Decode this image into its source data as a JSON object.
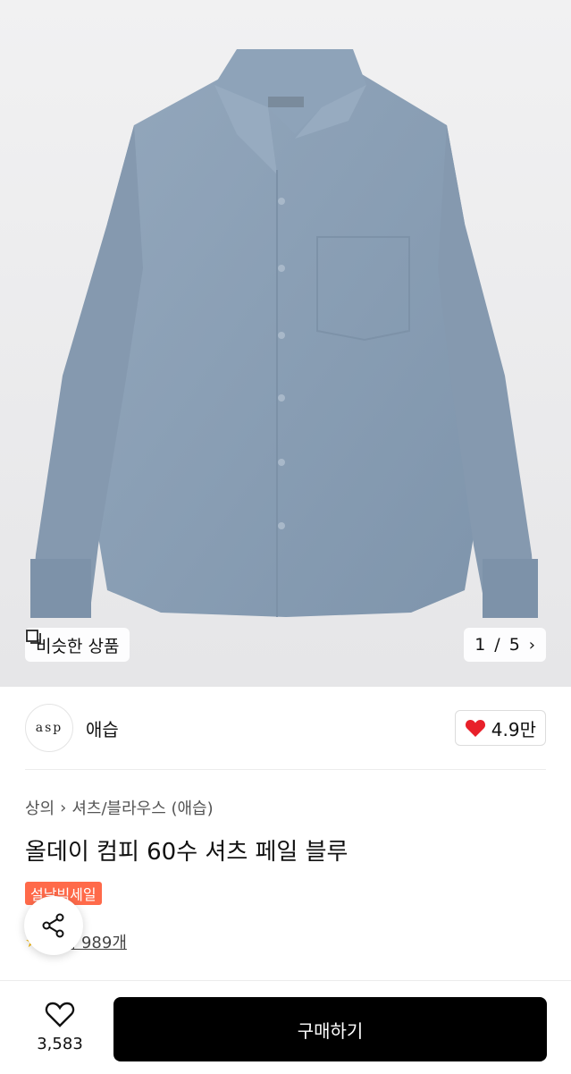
{
  "hero": {
    "similar_label": "비슷한 상품",
    "page_current": "1",
    "page_sep": "/",
    "page_total": "5"
  },
  "brand": {
    "logo_text": "asp",
    "name": "애습",
    "likes": "4.9만"
  },
  "product": {
    "breadcrumb": [
      "상의",
      "셔츠/블라우스 (애습)"
    ],
    "title": "올데이 컴피 60수 셔츠 페일 블루",
    "badge": "설날빅세일",
    "review_label": "후기 989개"
  },
  "bottom": {
    "wish_count": "3,583",
    "buy_label": "구매하기"
  },
  "colors": {
    "accent_red": "#e8202a",
    "badge": "#ff6a4a",
    "shirt": "#8ca0b6"
  },
  "icons": [
    "copy-icon",
    "chevron-right-icon",
    "heart-filled-icon",
    "share-icon",
    "heart-outline-icon",
    "star-icon"
  ]
}
